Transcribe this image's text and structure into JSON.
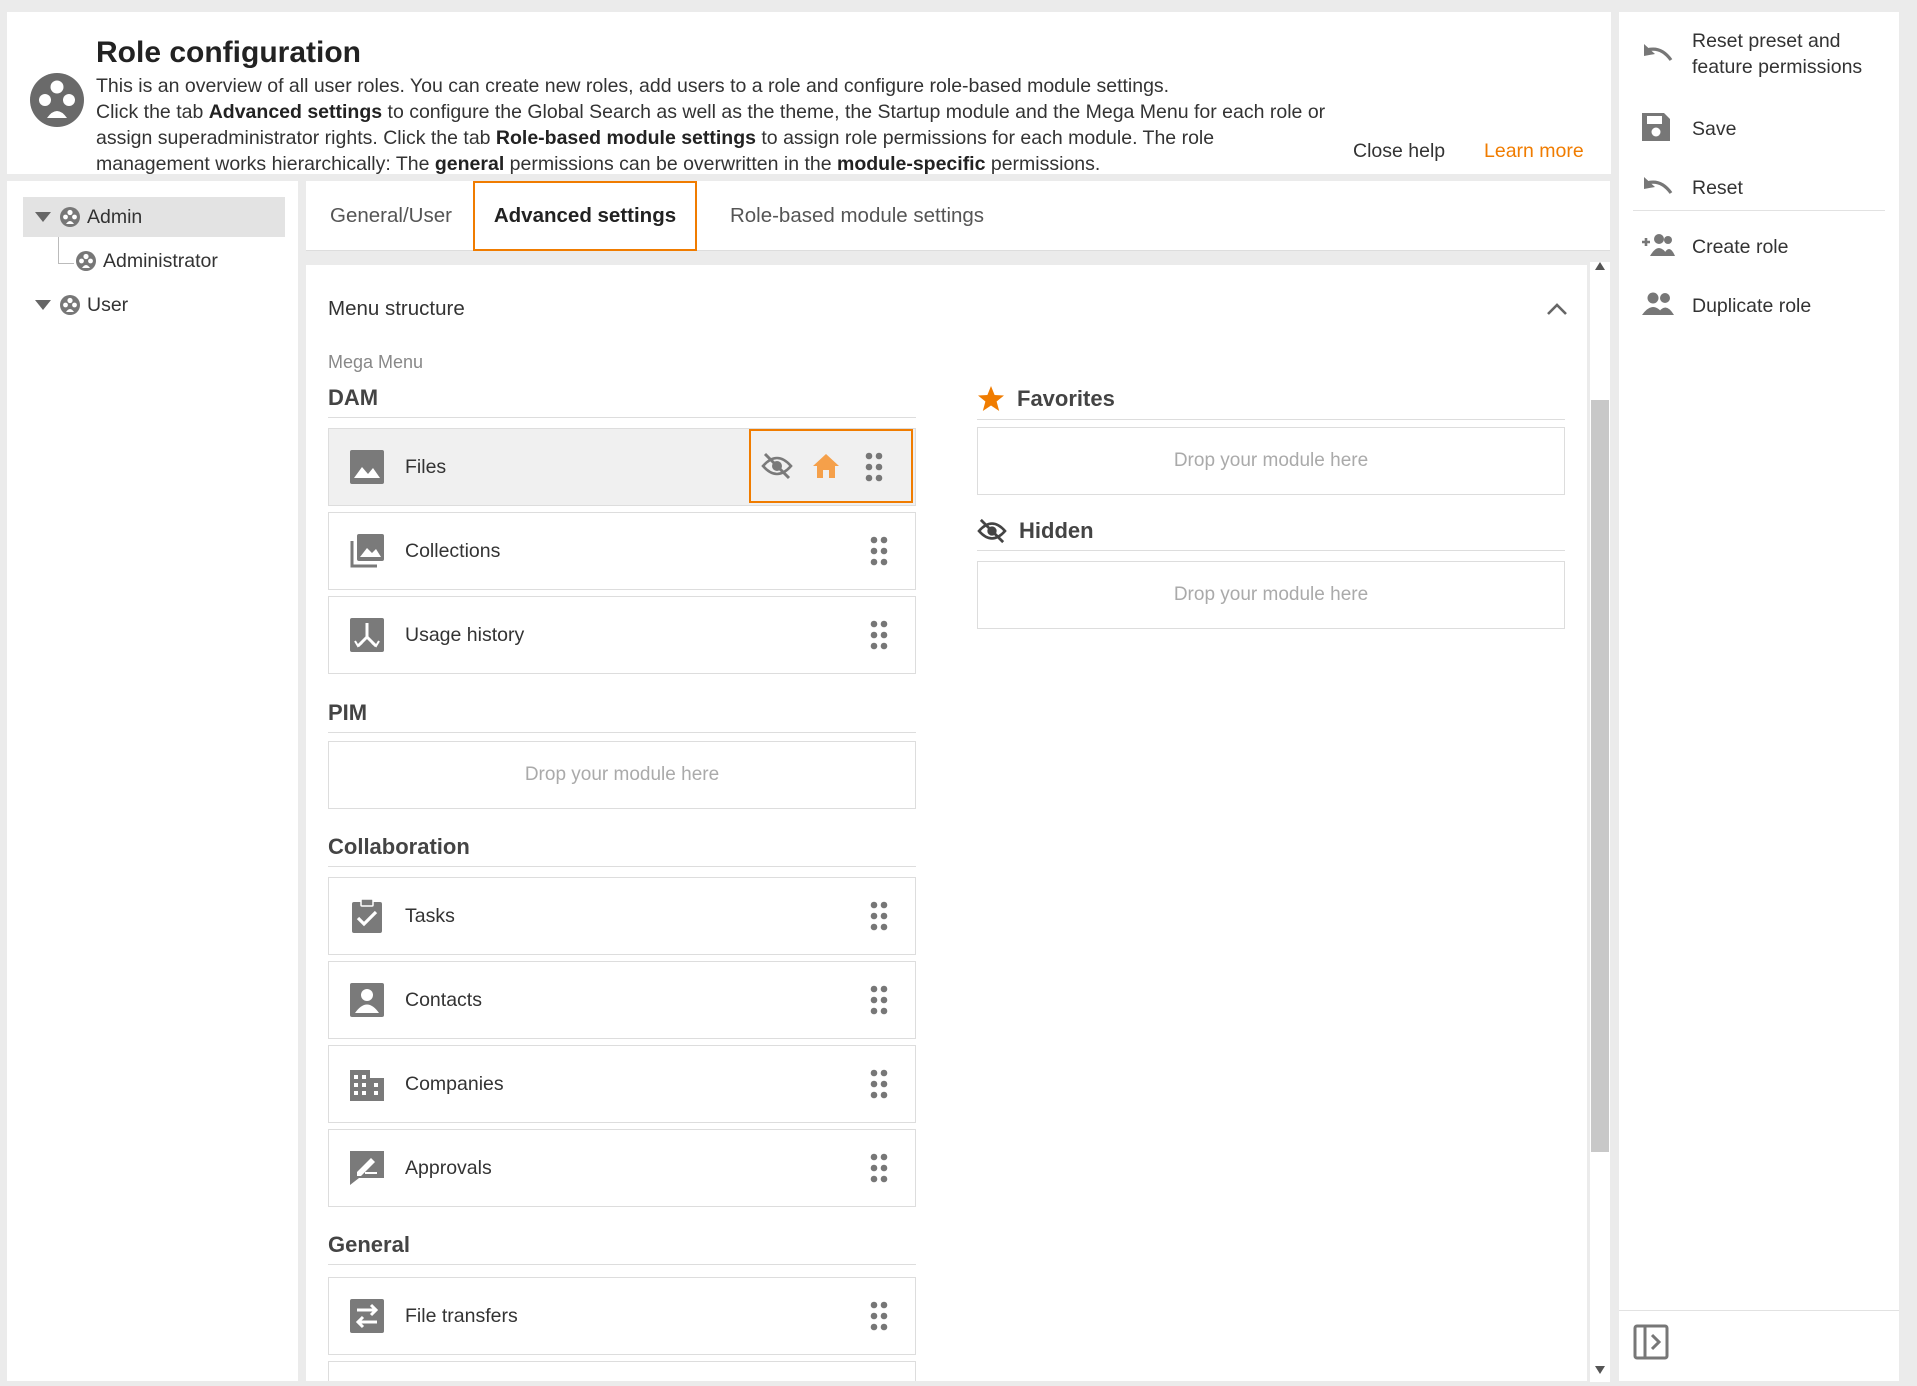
{
  "help": {
    "title": "Role configuration",
    "line1": "This is an overview of all user roles. You can create new roles, add users to a role and configure role-based module settings.",
    "line2_a": "Click the tab ",
    "line2_b": "Advanced settings",
    "line2_c": " to configure the Global Search as well as the theme, the Startup module and the Mega Menu for each role or assign superadministrator rights. Click the tab ",
    "line2_d": "Role-based module settings",
    "line2_e": " to assign role permissions for each module. The role management works hierarchically: The ",
    "line2_f": "general",
    "line2_g": " permissions can be overwritten in the ",
    "line2_h": "module-specific",
    "line2_i": " permissions.",
    "close_help": "Close help",
    "learn_more": "Learn more"
  },
  "tree": {
    "items": [
      {
        "label": "Admin"
      },
      {
        "label": "Administrator"
      },
      {
        "label": "User"
      }
    ]
  },
  "tabs": [
    {
      "label": "General/User"
    },
    {
      "label": "Advanced settings"
    },
    {
      "label": "Role-based module settings"
    }
  ],
  "menu": {
    "heading": "Menu structure",
    "mega_label": "Mega Menu",
    "drop_text": "Drop your module here",
    "groups": {
      "dam": "DAM",
      "pim": "PIM",
      "collaboration": "Collaboration",
      "general": "General",
      "favorites": "Favorites",
      "hidden": "Hidden"
    },
    "modules": {
      "files": "Files",
      "collections": "Collections",
      "usage_history": "Usage history",
      "tasks": "Tasks",
      "contacts": "Contacts",
      "companies": "Companies",
      "approvals": "Approvals",
      "file_transfers": "File transfers"
    }
  },
  "sidebar": {
    "reset_preset_line1": "Reset preset and",
    "reset_preset_line2": "feature permissions",
    "save": "Save",
    "reset": "Reset",
    "create_role": "Create role",
    "duplicate_role": "Duplicate role"
  },
  "colors": {
    "accent": "#f07c00",
    "icon_gray": "#7a7a7a"
  }
}
